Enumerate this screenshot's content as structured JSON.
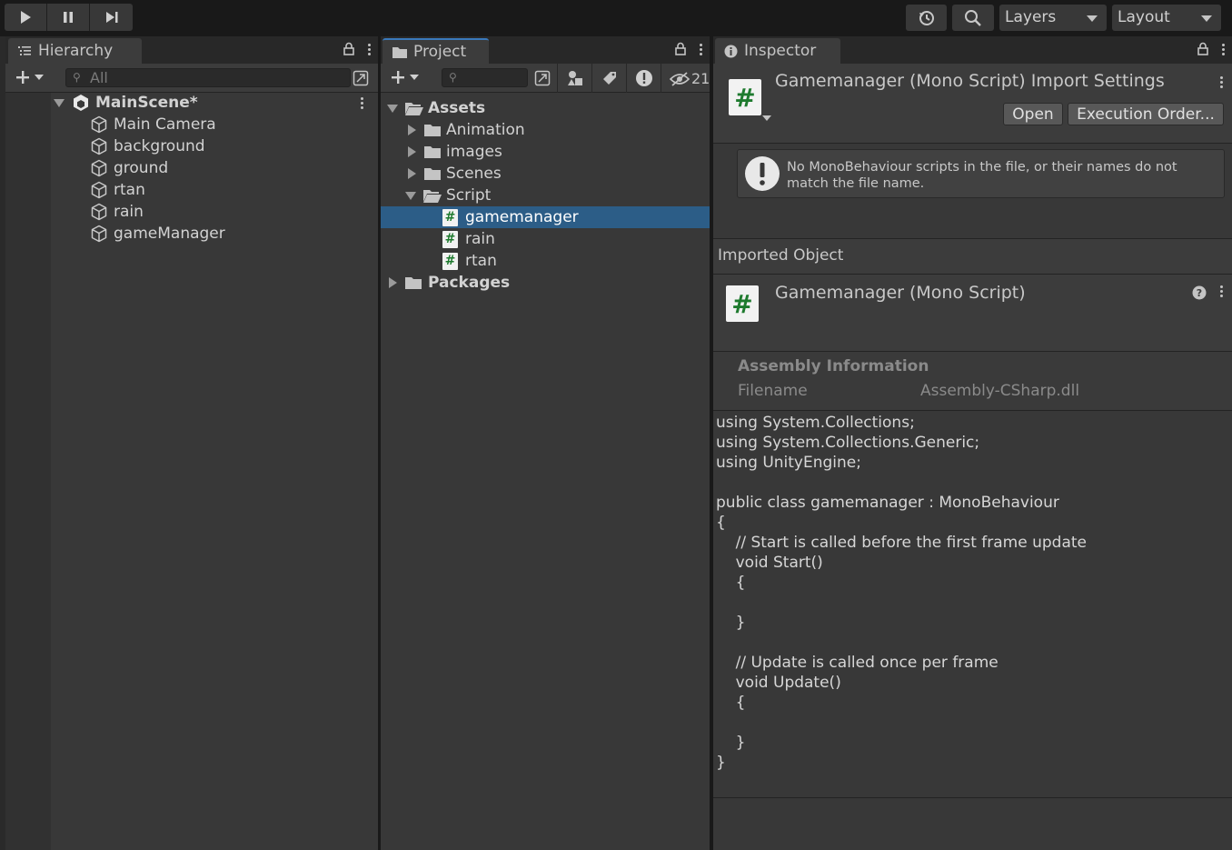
{
  "toolbar": {
    "layers_label": "Layers",
    "layout_label": "Layout"
  },
  "hierarchy": {
    "tab_label": "Hierarchy",
    "search_placeholder": "All",
    "scene_name": "MainScene*",
    "objects": [
      "Main Camera",
      "background",
      "ground",
      "rtan",
      "rain",
      "gameManager"
    ]
  },
  "project": {
    "tab_label": "Project",
    "hidden_count": "21",
    "tree": {
      "assets": "Assets",
      "animation": "Animation",
      "images": "images",
      "scenes": "Scenes",
      "script": "Script",
      "scripts": [
        "gamemanager",
        "rain",
        "rtan"
      ],
      "packages": "Packages"
    },
    "selected": "gamemanager"
  },
  "inspector": {
    "tab_label": "Inspector",
    "title": "Gamemanager (Mono Script) Import Settings",
    "open_label": "Open",
    "execution_order_label": "Execution Order...",
    "warning": "No MonoBehaviour scripts in the file, or their names do not match the file name.",
    "warning_line1": "No MonoBehaviour scripts in the file, or their names do not",
    "warning_line2": "match the file name.",
    "imported_object_label": "Imported Object",
    "object_title": "Gamemanager (Mono Script)",
    "assembly_heading": "Assembly Information",
    "filename_label": "Filename",
    "filename_value": "Assembly-CSharp.dll",
    "source_code": "using System.Collections;\nusing System.Collections.Generic;\nusing UnityEngine;\n\npublic class gamemanager : MonoBehaviour\n{\n    // Start is called before the first frame update\n    void Start()\n    {\n        \n    }\n\n    // Update is called once per frame\n    void Update()\n    {\n        \n    }\n}"
  },
  "colors": {
    "selection": "#2c5d87",
    "script_icon_hash": "#1e7a2e",
    "panel_bg": "#383838"
  },
  "icons": [
    "play-icon",
    "pause-icon",
    "step-icon",
    "history-icon",
    "search-icon",
    "list-icon",
    "lock-icon",
    "kebab-icon",
    "plus-icon",
    "folder-icon",
    "gameobject-icon",
    "unity-scene-icon",
    "script-icon",
    "info-icon",
    "warning-icon",
    "help-icon",
    "eye-slash-icon",
    "tag-icon",
    "filter-type-icon"
  ]
}
